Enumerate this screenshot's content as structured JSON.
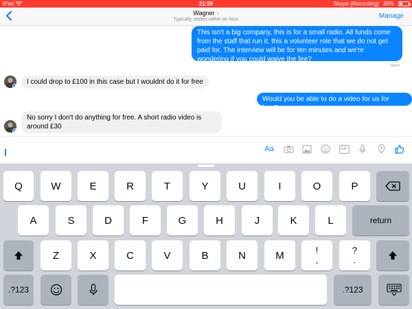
{
  "status_bar": {
    "device": "iPad",
    "time": "21:59",
    "recording": "Skype (Recording)",
    "battery": "30%"
  },
  "header": {
    "contact_name": "Wagner",
    "subtitle": "Typically replies within an hour",
    "manage_label": "Manage"
  },
  "messages": [
    {
      "direction": "outgoing",
      "text": "This isn't a big company, this is for a small radio. All funds come from the staff that run it, this a volunteer role that we do not get paid for. The interview will be for ten minutes and we're wondering if you could waive the fee?"
    },
    {
      "direction": "incoming",
      "text": "I could drop to £100 in this case but I wouldnt do it for free"
    },
    {
      "direction": "outgoing",
      "text": "Would you be able to do a video for us for free?"
    },
    {
      "direction": "incoming",
      "text": "No sorry I don't do anything for free.  A short radio video is around £30"
    }
  ],
  "seen_label": "Seen",
  "composer": {
    "aa_label": "Aa",
    "tool_icons": [
      "camera-icon",
      "photo-icon",
      "emoji-icon",
      "gif-icon",
      "microphone-icon",
      "location-icon",
      "thumbs-up-icon"
    ],
    "gif_label": "GIF"
  },
  "keyboard": {
    "row1": [
      "Q",
      "W",
      "E",
      "R",
      "T",
      "Y",
      "U",
      "I",
      "O",
      "P"
    ],
    "row2": [
      "A",
      "S",
      "D",
      "F",
      "G",
      "H",
      "J",
      "K",
      "L"
    ],
    "row3": [
      "Z",
      "X",
      "C",
      "V",
      "B",
      "N",
      "M"
    ],
    "return_label": "return",
    "numbers_label": ".?123",
    "exclaim_top": "!",
    "exclaim_bottom": ",",
    "question_top": "?",
    "question_bottom": "."
  },
  "colors": {
    "status_bar": "#ff3b30",
    "accent": "#0a84ff",
    "incoming_bubble": "#f1f0f0",
    "keyboard_bg": "#d1d5db"
  }
}
